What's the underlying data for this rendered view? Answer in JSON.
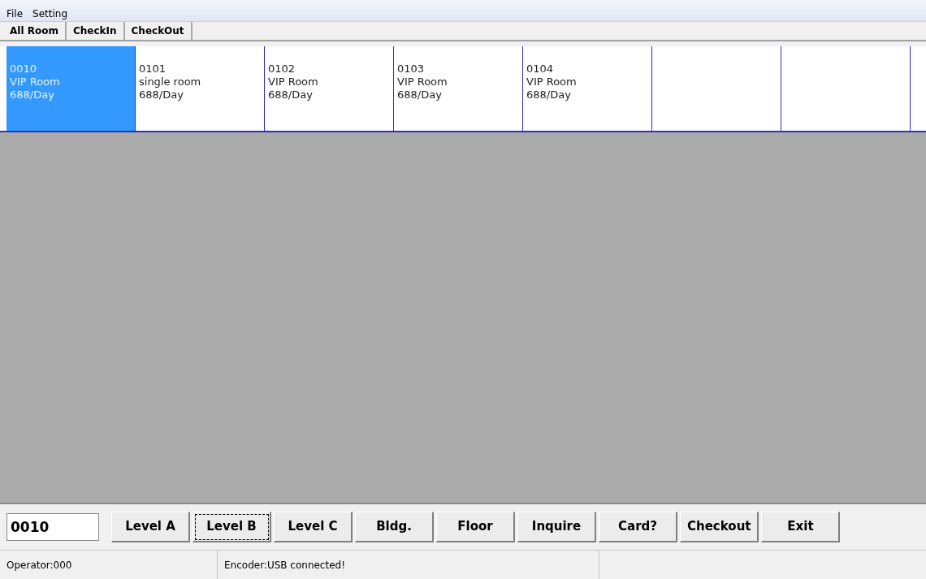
{
  "menu": [
    "File",
    "Setting"
  ],
  "tabs": [
    {
      "label": "All Room"
    },
    {
      "label": "CheckIn"
    },
    {
      "label": "CheckOut"
    }
  ],
  "rooms": [
    {
      "kind": "room",
      "number": "0010",
      "type": "VIP Room",
      "price": "688/Day",
      "selected": true
    },
    {
      "kind": "room",
      "number": "0101",
      "type": "single room",
      "price": "688/Day",
      "selected": false
    },
    {
      "kind": "room",
      "number": "0102",
      "type": "VIP Room",
      "price": "688/Day",
      "selected": false
    },
    {
      "kind": "room",
      "number": "0103",
      "type": "VIP Room",
      "price": "688/Day",
      "selected": false
    },
    {
      "kind": "room",
      "number": "0104",
      "type": "VIP Room",
      "price": "688/Day",
      "selected": false
    },
    {
      "kind": "empty",
      "selected": false
    },
    {
      "kind": "empty",
      "selected": false
    }
  ],
  "room_field": {
    "value": "0010"
  },
  "buttons": [
    {
      "label": "Level A",
      "focused": false
    },
    {
      "label": "Level B",
      "focused": true
    },
    {
      "label": "Level C",
      "focused": false
    },
    {
      "label": "Bldg.",
      "focused": false
    },
    {
      "label": "Floor",
      "focused": false
    },
    {
      "label": "Inquire",
      "focused": false
    },
    {
      "label": "Card?",
      "focused": false
    },
    {
      "label": "Checkout",
      "focused": false
    },
    {
      "label": "Exit",
      "focused": false
    }
  ],
  "status_bar": [
    "Operator:000",
    "Encoder:USB connected!"
  ]
}
